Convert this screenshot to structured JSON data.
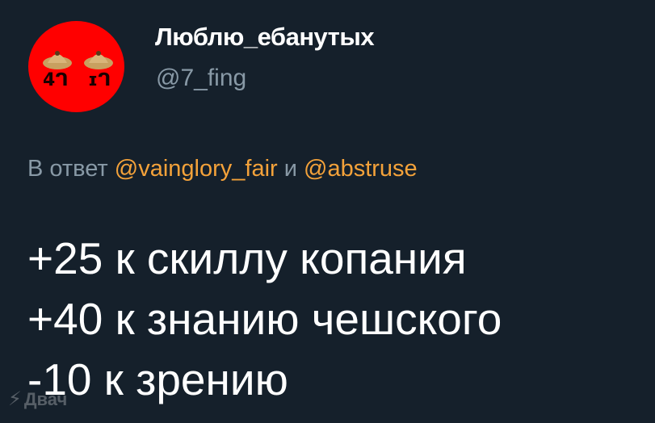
{
  "author": {
    "display_name": "Люблю_ебанутых",
    "handle": "@7_fing",
    "avatar_text_left": "4ᒉ",
    "avatar_text_right": "ɪᒉ"
  },
  "reply": {
    "prefix": "В ответ",
    "mention1": "@vainglory_fair",
    "conjunction": "и",
    "mention2": "@abstruse"
  },
  "body": {
    "lines": [
      "+25 к скиллу копания",
      "+40 к знанию чешского",
      "-10 к зрению"
    ]
  },
  "watermark": {
    "icon": "lightning-icon",
    "text": "Двач"
  },
  "colors": {
    "background": "#15202b",
    "accent_mention": "#f4a23a",
    "secondary_text": "#8899a6",
    "avatar_bg": "#ff0000"
  }
}
